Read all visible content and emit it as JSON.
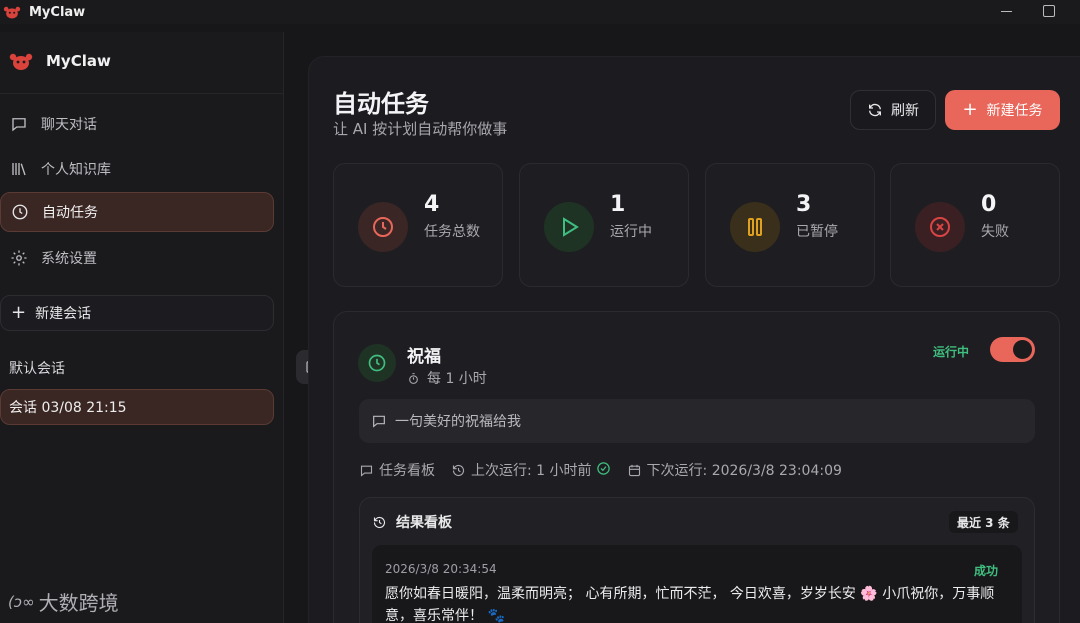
{
  "window": {
    "title": "MyClaw"
  },
  "sidebar": {
    "brand": "MyClaw",
    "nav": [
      {
        "label": "聊天对话",
        "icon": "chat-icon"
      },
      {
        "label": "个人知识库",
        "icon": "library-icon"
      },
      {
        "label": "自动任务",
        "icon": "clock-icon",
        "active": true
      },
      {
        "label": "系统设置",
        "icon": "gear-icon"
      }
    ],
    "new_chat_label": "新建会话",
    "section_label": "默认会话",
    "sessions": [
      {
        "label": "会话 03/08 21:15",
        "active": true
      }
    ]
  },
  "header": {
    "title": "自动任务",
    "subtitle": "让 AI 按计划自动帮你做事",
    "refresh_label": "刷新",
    "new_task_label": "新建任务"
  },
  "stats": [
    {
      "value": "4",
      "label": "任务总数",
      "color": "#e8665a"
    },
    {
      "value": "1",
      "label": "运行中",
      "color": "#3fbf7f"
    },
    {
      "value": "3",
      "label": "已暂停",
      "color": "#e0a020"
    },
    {
      "value": "0",
      "label": "失败",
      "color": "#d94444"
    }
  ],
  "task": {
    "name": "祝福",
    "schedule": "每 1 小时",
    "status": "运行中",
    "enabled": true,
    "prompt": "一句美好的祝福给我",
    "board_label": "任务看板",
    "last_run": "上次运行: 1 小时前",
    "next_run": "下次运行: 2026/3/8 23:04:09"
  },
  "results": {
    "title": "结果看板",
    "badge": "最近 3 条",
    "items": [
      {
        "time": "2026/3/8 20:34:54",
        "status": "成功",
        "text": "愿你如春日暖阳，温柔而明亮；  心有所期，忙而不茫，  今日欢喜，岁岁长安 🌸 小爪祝你，万事顺意，喜乐常伴！ 🐾"
      }
    ]
  },
  "watermark": {
    "text": "大数跨境"
  },
  "colors": {
    "accent": "#e8665a",
    "success": "#3fbf7f",
    "background": "#17171a"
  }
}
